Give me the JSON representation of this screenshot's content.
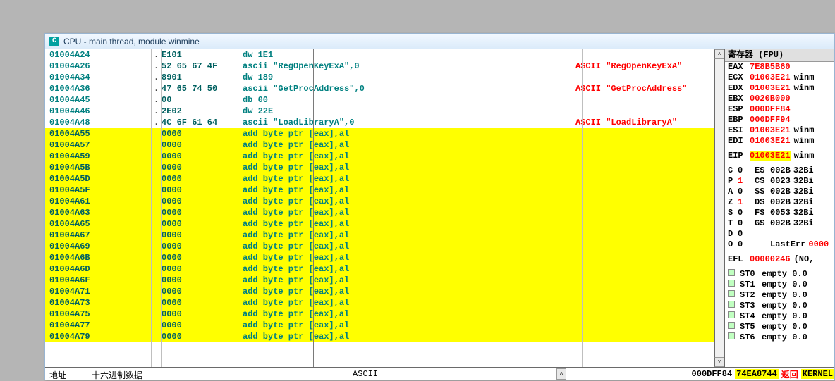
{
  "window": {
    "title": "CPU - main thread, module winmine",
    "icon": "C"
  },
  "disasm": [
    {
      "addr": "01004A24",
      "dot": ".",
      "hex": "E101",
      "asm": "dw 1E1",
      "cmt": "",
      "hi": false
    },
    {
      "addr": "01004A26",
      "dot": ".",
      "hex": "52 65 67 4F",
      "asm": "ascii \"RegOpenKeyExA\",0",
      "cmt": "ASCII \"RegOpenKeyExA\"",
      "hi": false
    },
    {
      "addr": "01004A34",
      "dot": ".",
      "hex": "8901",
      "asm": "dw 189",
      "cmt": "",
      "hi": false
    },
    {
      "addr": "01004A36",
      "dot": ".",
      "hex": "47 65 74 50",
      "asm": "ascii \"GetProcAddress\",0",
      "cmt": "ASCII \"GetProcAddress\"",
      "hi": false
    },
    {
      "addr": "01004A45",
      "dot": ".",
      "hex": "00",
      "asm": "db 00",
      "cmt": "",
      "hi": false
    },
    {
      "addr": "01004A46",
      "dot": ".",
      "hex": "2E02",
      "asm": "dw 22E",
      "cmt": "",
      "hi": false
    },
    {
      "addr": "01004A48",
      "dot": ".",
      "hex": "4C 6F 61 64",
      "asm": "ascii \"LoadLibraryA\",0",
      "cmt": "ASCII \"LoadLibraryA\"",
      "hi": false
    },
    {
      "addr": "01004A55",
      "dot": "",
      "hex": "0000",
      "asm": "add byte ptr [eax],al",
      "cmt": "",
      "hi": true
    },
    {
      "addr": "01004A57",
      "dot": "",
      "hex": "0000",
      "asm": "add byte ptr [eax],al",
      "cmt": "",
      "hi": true
    },
    {
      "addr": "01004A59",
      "dot": "",
      "hex": "0000",
      "asm": "add byte ptr [eax],al",
      "cmt": "",
      "hi": true
    },
    {
      "addr": "01004A5B",
      "dot": "",
      "hex": "0000",
      "asm": "add byte ptr [eax],al",
      "cmt": "",
      "hi": true
    },
    {
      "addr": "01004A5D",
      "dot": "",
      "hex": "0000",
      "asm": "add byte ptr [eax],al",
      "cmt": "",
      "hi": true
    },
    {
      "addr": "01004A5F",
      "dot": "",
      "hex": "0000",
      "asm": "add byte ptr [eax],al",
      "cmt": "",
      "hi": true
    },
    {
      "addr": "01004A61",
      "dot": "",
      "hex": "0000",
      "asm": "add byte ptr [eax],al",
      "cmt": "",
      "hi": true
    },
    {
      "addr": "01004A63",
      "dot": "",
      "hex": "0000",
      "asm": "add byte ptr [eax],al",
      "cmt": "",
      "hi": true
    },
    {
      "addr": "01004A65",
      "dot": "",
      "hex": "0000",
      "asm": "add byte ptr [eax],al",
      "cmt": "",
      "hi": true
    },
    {
      "addr": "01004A67",
      "dot": "",
      "hex": "0000",
      "asm": "add byte ptr [eax],al",
      "cmt": "",
      "hi": true
    },
    {
      "addr": "01004A69",
      "dot": "",
      "hex": "0000",
      "asm": "add byte ptr [eax],al",
      "cmt": "",
      "hi": true
    },
    {
      "addr": "01004A6B",
      "dot": "",
      "hex": "0000",
      "asm": "add byte ptr [eax],al",
      "cmt": "",
      "hi": true
    },
    {
      "addr": "01004A6D",
      "dot": "",
      "hex": "0000",
      "asm": "add byte ptr [eax],al",
      "cmt": "",
      "hi": true
    },
    {
      "addr": "01004A6F",
      "dot": "",
      "hex": "0000",
      "asm": "add byte ptr [eax],al",
      "cmt": "",
      "hi": true
    },
    {
      "addr": "01004A71",
      "dot": "",
      "hex": "0000",
      "asm": "add byte ptr [eax],al",
      "cmt": "",
      "hi": true
    },
    {
      "addr": "01004A73",
      "dot": "",
      "hex": "0000",
      "asm": "add byte ptr [eax],al",
      "cmt": "",
      "hi": true
    },
    {
      "addr": "01004A75",
      "dot": "",
      "hex": "0000",
      "asm": "add byte ptr [eax],al",
      "cmt": "",
      "hi": true
    },
    {
      "addr": "01004A77",
      "dot": "",
      "hex": "0000",
      "asm": "add byte ptr [eax],al",
      "cmt": "",
      "hi": true
    },
    {
      "addr": "01004A79",
      "dot": "",
      "hex": "0000",
      "asm": "add byte ptr [eax],al",
      "cmt": "",
      "hi": true
    }
  ],
  "regs": {
    "header": "寄存器 (FPU)",
    "gpr": [
      {
        "n": "EAX",
        "v": "7E8B5B60",
        "note": ""
      },
      {
        "n": "ECX",
        "v": "01003E21",
        "note": "winm"
      },
      {
        "n": "EDX",
        "v": "01003E21",
        "note": "winm"
      },
      {
        "n": "EBX",
        "v": "0020B000",
        "note": ""
      },
      {
        "n": "ESP",
        "v": "000DFF84",
        "note": ""
      },
      {
        "n": "EBP",
        "v": "000DFF94",
        "note": ""
      },
      {
        "n": "ESI",
        "v": "01003E21",
        "note": "winm"
      },
      {
        "n": "EDI",
        "v": "01003E21",
        "note": "winm"
      }
    ],
    "eip": {
      "n": "EIP",
      "v": "01003E21",
      "note": "winm"
    },
    "flags": [
      {
        "n": "C",
        "v": "0",
        "seg": "ES",
        "sv": "002B",
        "ex": "32Bi"
      },
      {
        "n": "P",
        "v": "1",
        "seg": "CS",
        "sv": "0023",
        "ex": "32Bi"
      },
      {
        "n": "A",
        "v": "0",
        "seg": "SS",
        "sv": "002B",
        "ex": "32Bi"
      },
      {
        "n": "Z",
        "v": "1",
        "seg": "DS",
        "sv": "002B",
        "ex": "32Bi"
      },
      {
        "n": "S",
        "v": "0",
        "seg": "FS",
        "sv": "0053",
        "ex": "32Bi"
      },
      {
        "n": "T",
        "v": "0",
        "seg": "GS",
        "sv": "002B",
        "ex": "32Bi"
      },
      {
        "n": "D",
        "v": "0",
        "seg": "",
        "sv": "",
        "ex": ""
      },
      {
        "n": "O",
        "v": "0",
        "seg": "",
        "sv": "LastErr",
        "ex": "0000"
      }
    ],
    "efl": {
      "n": "EFL",
      "v": "00000246",
      "note": "(NO,"
    },
    "fpu": [
      {
        "n": "ST0",
        "v": "empty 0.0"
      },
      {
        "n": "ST1",
        "v": "empty 0.0"
      },
      {
        "n": "ST2",
        "v": "empty 0.0"
      },
      {
        "n": "ST3",
        "v": "empty 0.0"
      },
      {
        "n": "ST4",
        "v": "empty 0.0"
      },
      {
        "n": "ST5",
        "v": "empty 0.0"
      },
      {
        "n": "ST6",
        "v": "empty 0.0"
      }
    ]
  },
  "bottom": {
    "cols": [
      "地址",
      "十六进制数据",
      "ASCII"
    ],
    "right": {
      "a1": "000DFF84",
      "a2": "74EA8744",
      "txt": "返回",
      "k": "KERNEL"
    }
  }
}
